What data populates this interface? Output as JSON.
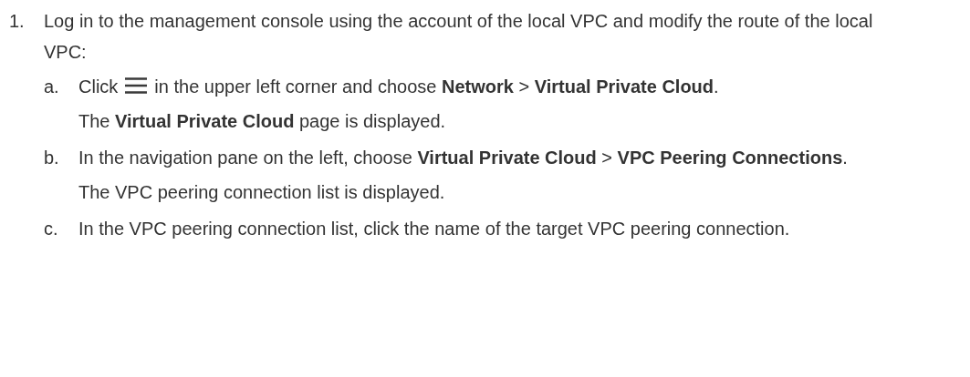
{
  "steps": [
    {
      "marker": "1.",
      "text": "Log in to the management console using the account of the local VPC and modify the route of the local VPC:",
      "substeps": [
        {
          "marker": "a.",
          "kind": "icon-step",
          "before": "Click",
          "text": "in the upper left corner and choose **Network** > **Virtual Private Cloud**.",
          "result": "The **Virtual Private Cloud** page is displayed."
        },
        {
          "marker": "b.",
          "kind": "text",
          "text": "In the navigation pane on the left, choose **Virtual Private Cloud** > **VPC Peering Connections**.",
          "result": "The VPC peering connection list is displayed."
        },
        {
          "marker": "c.",
          "kind": "text",
          "text": "In the VPC peering connection list, click the name of the target VPC peering connection."
        }
      ]
    }
  ]
}
